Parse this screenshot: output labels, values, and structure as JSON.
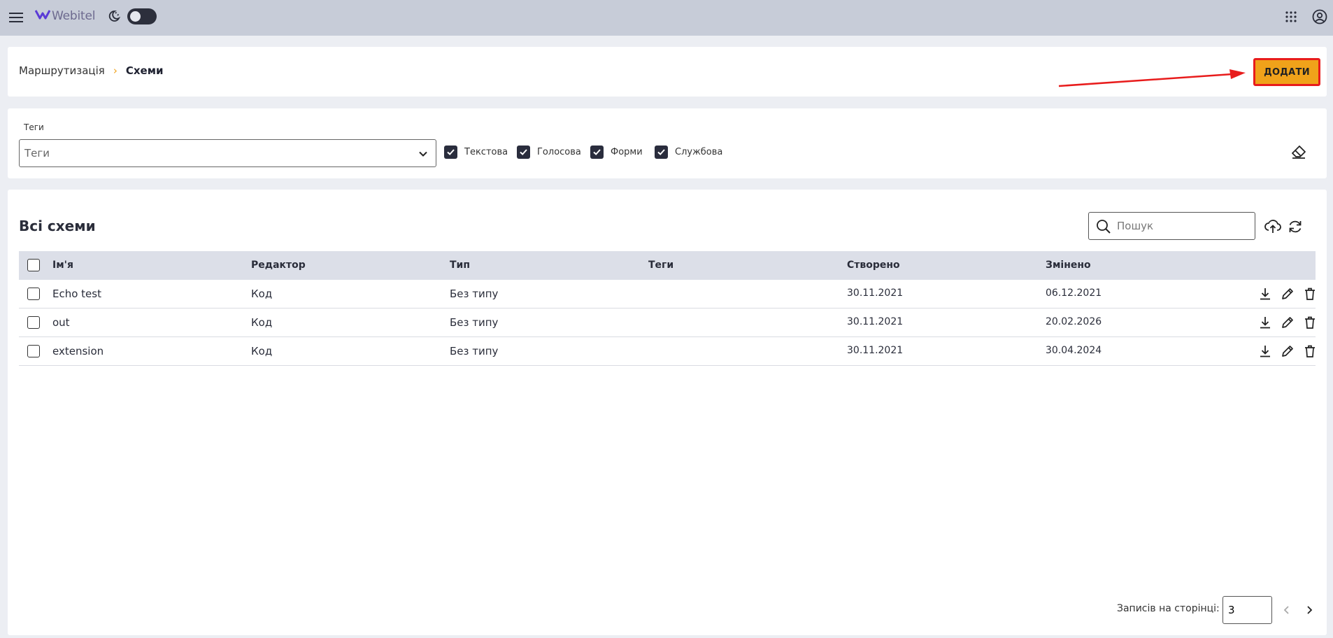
{
  "topbar": {
    "logo_text": "Webitel",
    "icons": [
      "menu-icon",
      "webitel-logo-icon",
      "phone-moon-icon",
      "apps-grid-icon",
      "account-circle-icon"
    ]
  },
  "header": {
    "breadcrumb": [
      "Маршрутизація",
      "Схеми"
    ],
    "breadcrumb_separator": "›",
    "add_label": "ДОДАТИ"
  },
  "filter": {
    "tags_label": "Теги",
    "tags_placeholder": "Теги",
    "checkboxes": [
      {
        "label": "Текстова",
        "checked": true
      },
      {
        "label": "Голосова",
        "checked": true
      },
      {
        "label": "Форми",
        "checked": true
      },
      {
        "label": "Службова",
        "checked": true
      }
    ]
  },
  "table": {
    "title": "Всі схеми",
    "search_placeholder": "Пошук",
    "columns": [
      "Ім'я",
      "Редактор",
      "Тип",
      "Теги",
      "Створено",
      "Змінено"
    ],
    "rows": [
      {
        "name": "Echo test",
        "editor": "Код",
        "type": "Без типу",
        "tags": "",
        "created": "30.11.2021",
        "modified": "06.12.2021"
      },
      {
        "name": "out",
        "editor": "Код",
        "type": "Без типу",
        "tags": "",
        "created": "30.11.2021",
        "modified": "20.02.2026"
      },
      {
        "name": "extension",
        "editor": "Код",
        "type": "Без типу",
        "tags": "",
        "created": "30.11.2021",
        "modified": "30.04.2024"
      }
    ]
  },
  "pagination": {
    "per_page_label": "Записів на сторінці:",
    "per_page_value": "3"
  },
  "colors": {
    "accent": "#f0a21a",
    "highlight_border": "#e81c1c",
    "topbar": "#c7ccd8",
    "checkbox": "#2a2d3d"
  }
}
